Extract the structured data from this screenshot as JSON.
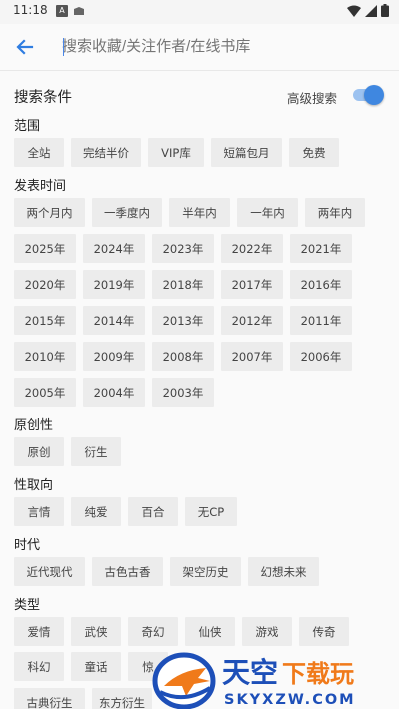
{
  "status": {
    "time": "11:18"
  },
  "toolbar": {
    "search_placeholder": "搜索收藏/关注作者/在线书库"
  },
  "header": {
    "title": "搜索条件",
    "advanced_label": "高级搜索",
    "advanced_on": true,
    "accent_color": "#3f87e0"
  },
  "scope": {
    "title": "范围",
    "options": [
      "全站",
      "完结半价",
      "VIP库",
      "短篇包月",
      "免费"
    ]
  },
  "publish_time": {
    "title": "发表时间",
    "options": [
      "两个月内",
      "一季度内",
      "半年内",
      "一年内",
      "两年内",
      "2025年",
      "2024年",
      "2023年",
      "2022年",
      "2021年",
      "2020年",
      "2019年",
      "2018年",
      "2017年",
      "2016年",
      "2015年",
      "2014年",
      "2013年",
      "2012年",
      "2011年",
      "2010年",
      "2009年",
      "2008年",
      "2007年",
      "2006年",
      "2005年",
      "2004年",
      "2003年"
    ]
  },
  "originality": {
    "title": "原创性",
    "options": [
      "原创",
      "衍生"
    ]
  },
  "orientation": {
    "title": "性取向",
    "options": [
      "言情",
      "纯爱",
      "百合",
      "无CP"
    ]
  },
  "era": {
    "title": "时代",
    "options": [
      "近代现代",
      "古色古香",
      "架空历史",
      "幻想未来"
    ]
  },
  "genre": {
    "title": "类型",
    "options": [
      "爱情",
      "武侠",
      "奇幻",
      "仙侠",
      "游戏",
      "传奇",
      "科幻",
      "童话",
      "惊",
      "古典衍生",
      "东方衍生"
    ]
  },
  "watermark": {
    "cn": "天空下载玩",
    "url": "SKYXZW.COM"
  }
}
